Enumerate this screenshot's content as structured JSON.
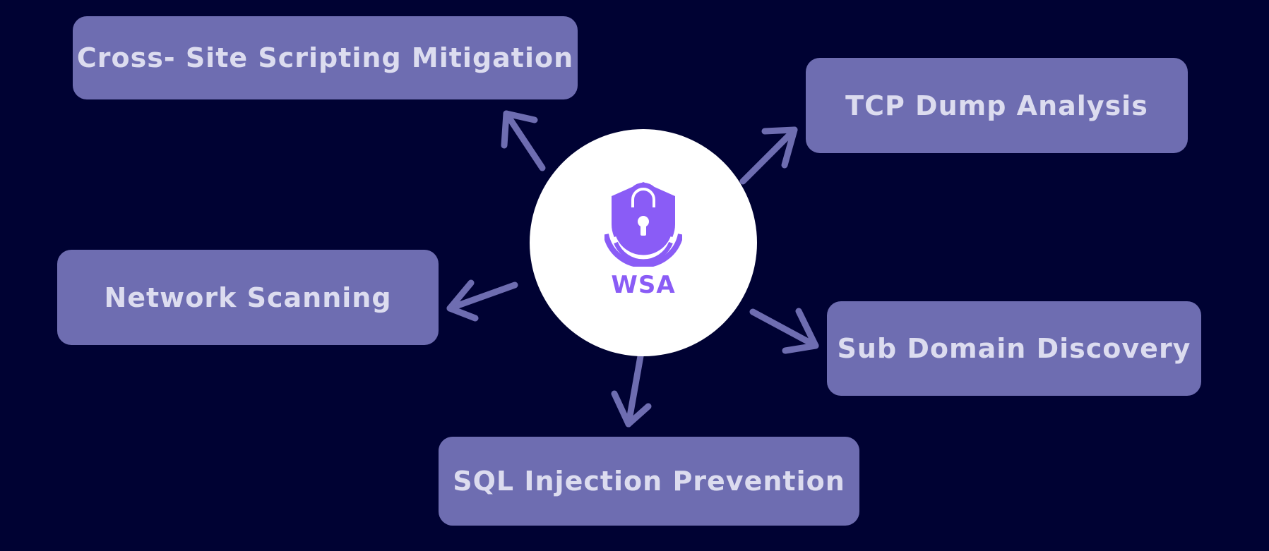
{
  "colors": {
    "background": "#000233",
    "node_fill": "#6e6db1",
    "node_text": "#dcdcef",
    "arrow": "#6e6db1",
    "hub_fill": "#ffffff",
    "brand_purple": "#8a5cf6"
  },
  "hub": {
    "label": "WSA",
    "icon": "shield-lock-icon"
  },
  "nodes": [
    {
      "id": "xss",
      "label": "Cross- Site Scripting Mitigation"
    },
    {
      "id": "tcp",
      "label": "TCP Dump Analysis"
    },
    {
      "id": "net",
      "label": "Network Scanning"
    },
    {
      "id": "sub",
      "label": "Sub Domain Discovery"
    },
    {
      "id": "sql",
      "label": "SQL Injection Prevention"
    }
  ]
}
